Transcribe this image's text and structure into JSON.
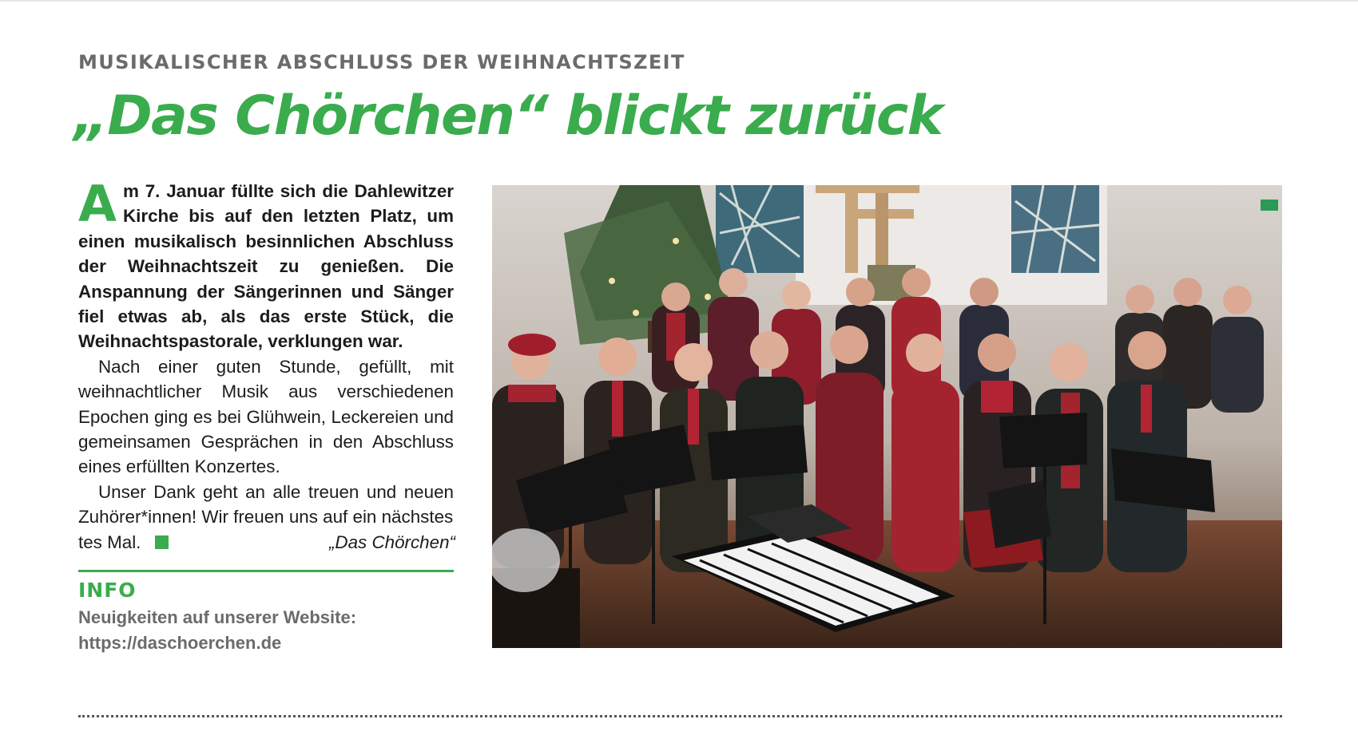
{
  "article": {
    "kicker": "MUSIKALISCHER ABSCHLUSS DER WEIHNACHTSZEIT",
    "headline": "„Das Chörchen“ blickt zurück",
    "dropcap": "A",
    "lead": "m 7. Januar füllte sich die Dahlewitzer Kirche bis auf den letzten Platz, um einen musikalisch besinnlichen Abschluss der Weihnachtszeit zu genießen. Die Anspannung der Sängerinnen und Sänger fiel etwas ab, als das erste Stück, die Weihnachtspastorale, verklungen war.",
    "paragraph2": "Nach einer guten Stunde, gefüllt, mit weihnachtlicher Musik aus verschiedenen Epochen ging es bei Glühwein, Leckereien und gemeinsamen Gesprächen in den Abschluss eines erfüllten Konzertes.",
    "paragraph3": "Unser Dank geht an alle treuen und neuen Zuhörer*innen! Wir freuen uns auf ein nächstes",
    "paragraph3_end": "tes Mal.",
    "signature": "„Das Chörchen“"
  },
  "info": {
    "heading": "INFO",
    "line1": "Neuigkeiten auf unserer Website:",
    "url": "https://daschoerchen.de"
  },
  "photo": {
    "subject": "choir-group-photo"
  },
  "colors": {
    "accent_green": "#3aac4d",
    "kicker_gray": "#6c6b69",
    "body_text": "#1c1c1c",
    "choir_red": "#a3232f"
  }
}
